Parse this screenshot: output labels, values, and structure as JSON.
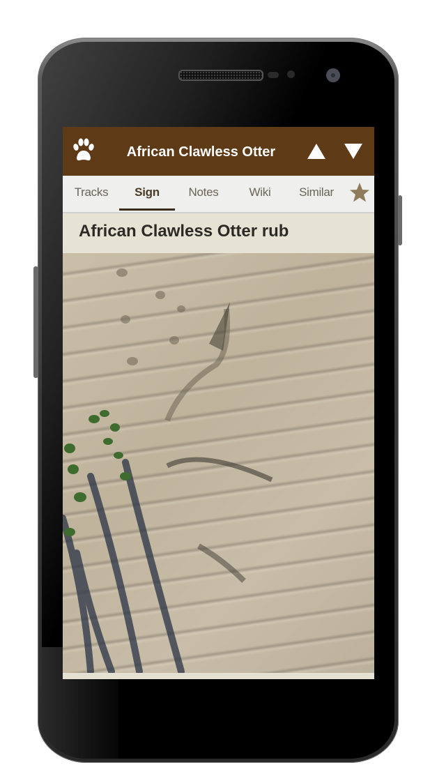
{
  "header": {
    "title": "African Clawless Otter",
    "icons": {
      "left": "paw-icon",
      "prev": "triangle-up-icon",
      "next": "triangle-down-icon"
    }
  },
  "tabs": [
    {
      "label": "Tracks",
      "active": false
    },
    {
      "label": "Sign",
      "active": true
    },
    {
      "label": "Notes",
      "active": false
    },
    {
      "label": "Wiki",
      "active": false
    },
    {
      "label": "Similar",
      "active": false
    }
  ],
  "favorite_icon": "star-icon",
  "section": {
    "title": "African Clawless Otter rub"
  },
  "photo": {
    "description": "Photo of otter rub marks and tracks in rippled sand with plant shadows"
  },
  "colors": {
    "header_bg": "#5e3a17",
    "tab_bg": "#efefed",
    "active_tab_underline": "#3a2c1c",
    "star": "#8d7b5a",
    "title_bg": "#e7e3d4"
  }
}
